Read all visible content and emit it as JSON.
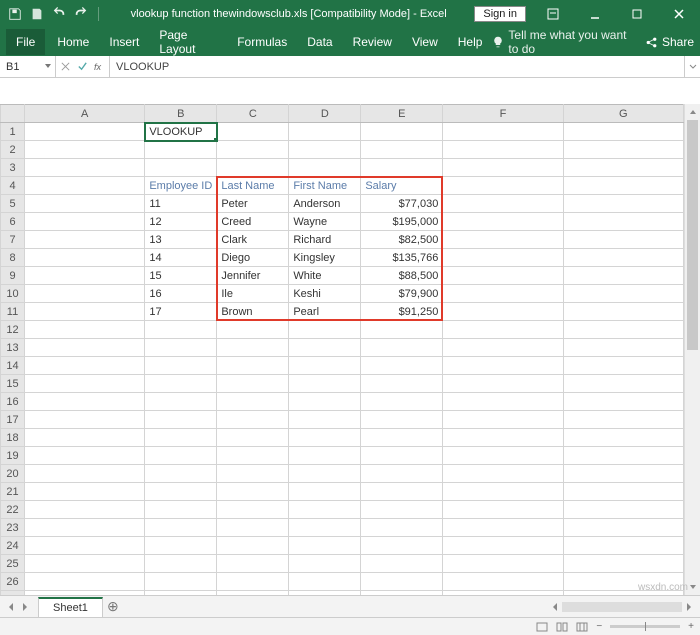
{
  "titlebar": {
    "doc": "vlookup function thewindowsclub.xls  [Compatibility Mode]  -  Excel",
    "signin": "Sign in"
  },
  "ribbon": {
    "tabs": [
      "File",
      "Home",
      "Insert",
      "Page Layout",
      "Formulas",
      "Data",
      "Review",
      "View",
      "Help"
    ],
    "tell": "Tell me what you want to do",
    "share": "Share"
  },
  "fbar": {
    "name": "B1",
    "value": "VLOOKUP"
  },
  "columns": [
    "A",
    "B",
    "C",
    "D",
    "E",
    "F",
    "G"
  ],
  "rows_count": 27,
  "selection": {
    "cell": "B1",
    "col": "B",
    "row": 1
  },
  "cells": {
    "B1": "VLOOKUP",
    "B4": "Employee ID",
    "C4": "Last Name",
    "D4": "First Name",
    "E4": "Salary",
    "B5": "11",
    "C5": "Peter",
    "D5": "Anderson",
    "E5": "$77,030",
    "B6": "12",
    "C6": "Creed",
    "D6": "Wayne",
    "E6": "$195,000",
    "B7": "13",
    "C7": "Clark",
    "D7": "Richard",
    "E7": "$82,500",
    "B8": "14",
    "C8": "Diego",
    "D8": "Kingsley",
    "E8": "$135,766",
    "B9": "15",
    "C9": "Jennifer",
    "D9": "White",
    "E9": "$88,500",
    "B10": "16",
    "C10": "Ile",
    "D10": "Keshi",
    "E10": "$79,900",
    "B11": "17",
    "C11": "Brown",
    "D11": "Pearl",
    "E11": "$91,250"
  },
  "sheettabs": {
    "active": "Sheet1"
  },
  "status": {
    "left": "",
    "zoom": ""
  },
  "redbox": {
    "top_row": 4,
    "bottom_row": 11,
    "left_col": "C",
    "right_col": "E"
  },
  "chart_data": {
    "type": "table",
    "title": "VLOOKUP example data",
    "columns": [
      "Employee ID",
      "Last Name",
      "First Name",
      "Salary"
    ],
    "rows": [
      [
        11,
        "Peter",
        "Anderson",
        77030
      ],
      [
        12,
        "Creed",
        "Wayne",
        195000
      ],
      [
        13,
        "Clark",
        "Richard",
        82500
      ],
      [
        14,
        "Diego",
        "Kingsley",
        135766
      ],
      [
        15,
        "Jennifer",
        "White",
        88500
      ],
      [
        16,
        "Ile",
        "Keshi",
        79900
      ],
      [
        17,
        "Brown",
        "Pearl",
        91250
      ]
    ]
  },
  "watermark": "wsxdn.com"
}
